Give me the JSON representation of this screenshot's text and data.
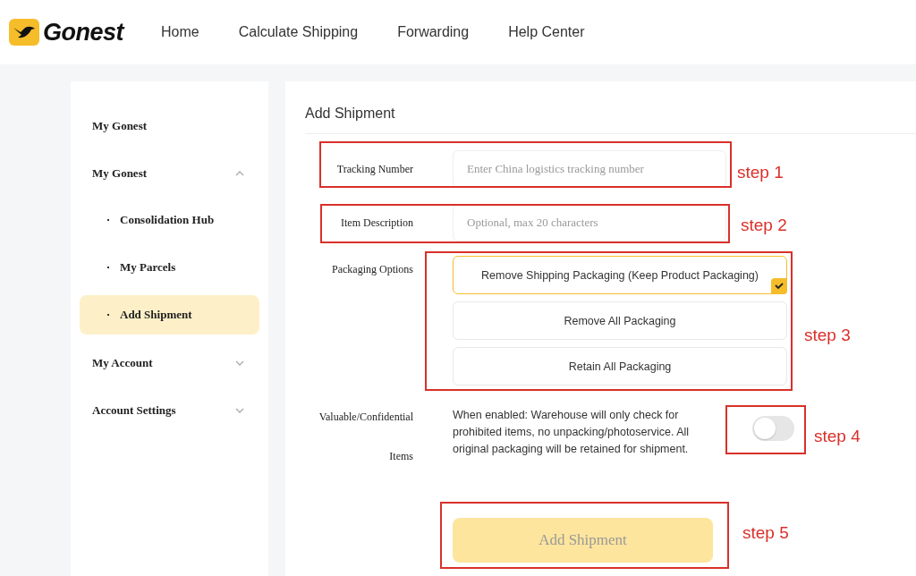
{
  "header": {
    "logo": "Gonest",
    "nav": [
      "Home",
      "Calculate Shipping",
      "Forwarding",
      "Help Center"
    ]
  },
  "sidebar": {
    "items": [
      {
        "label": "My Gonest"
      },
      {
        "label": "My Gonest",
        "expanded": true,
        "children": [
          {
            "label": "Consolidation Hub",
            "selected": false
          },
          {
            "label": "My Parcels",
            "selected": false
          },
          {
            "label": "Add Shipment",
            "selected": true
          }
        ]
      },
      {
        "label": "My Account",
        "expanded": false
      },
      {
        "label": "Account Settings",
        "expanded": false
      }
    ]
  },
  "page": {
    "title": "Add Shipment",
    "fields": [
      {
        "label": "Tracking Number",
        "placeholder": "Enter China logistics tracking number"
      },
      {
        "label": "Item Description",
        "placeholder": "Optional, max 20 characters"
      }
    ],
    "packaging": {
      "label": "Packaging Options",
      "options": [
        {
          "label": "Remove Shipping Packaging (Keep Product Packaging)",
          "selected": true
        },
        {
          "label": "Remove All Packaging",
          "selected": false
        },
        {
          "label": "Retain All Packaging",
          "selected": false
        }
      ]
    },
    "valuable": {
      "label": "Valuable/Confidential Items",
      "description": "When enabled: Warehouse will only check for prohibited items, no unpacking/photoservice. All original packaging will be retained for shipment.",
      "on": false
    },
    "submit": {
      "label": "Add Shipment",
      "disabled": true
    }
  },
  "annotations": [
    {
      "label": "step 1"
    },
    {
      "label": "step 2"
    },
    {
      "label": "step 3"
    },
    {
      "label": "step 4"
    },
    {
      "label": "step 5"
    }
  ]
}
